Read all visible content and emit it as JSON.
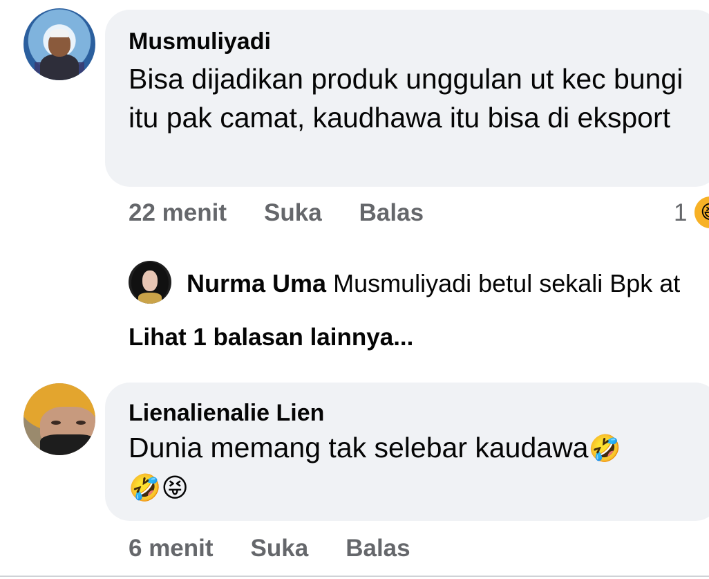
{
  "comments": [
    {
      "author": "Musmuliyadi",
      "text": "Bisa dijadikan produk unggulan ut kec bungi itu pak camat, kaudhawa itu bisa di eksport",
      "time": "22 menit",
      "like_label": "Suka",
      "reply_label": "Balas",
      "reaction_count": "1",
      "reaction_icon": "laughing-emoji",
      "reply": {
        "author": "Nurma Uma",
        "text": "Musmuliyadi betul sekali Bpk at"
      },
      "view_more": "Lihat 1 balasan lainnya..."
    },
    {
      "author": "Lienalienalie Lien",
      "text": "Dunia memang tak selebar kaudawa",
      "emojis": [
        "🤣",
        "🤣",
        "😝"
      ],
      "time": "6 menit",
      "like_label": "Suka",
      "reply_label": "Balas"
    }
  ],
  "colors": {
    "bubble": "#f0f2f5",
    "meta_text": "#65676b",
    "text": "#050505"
  }
}
